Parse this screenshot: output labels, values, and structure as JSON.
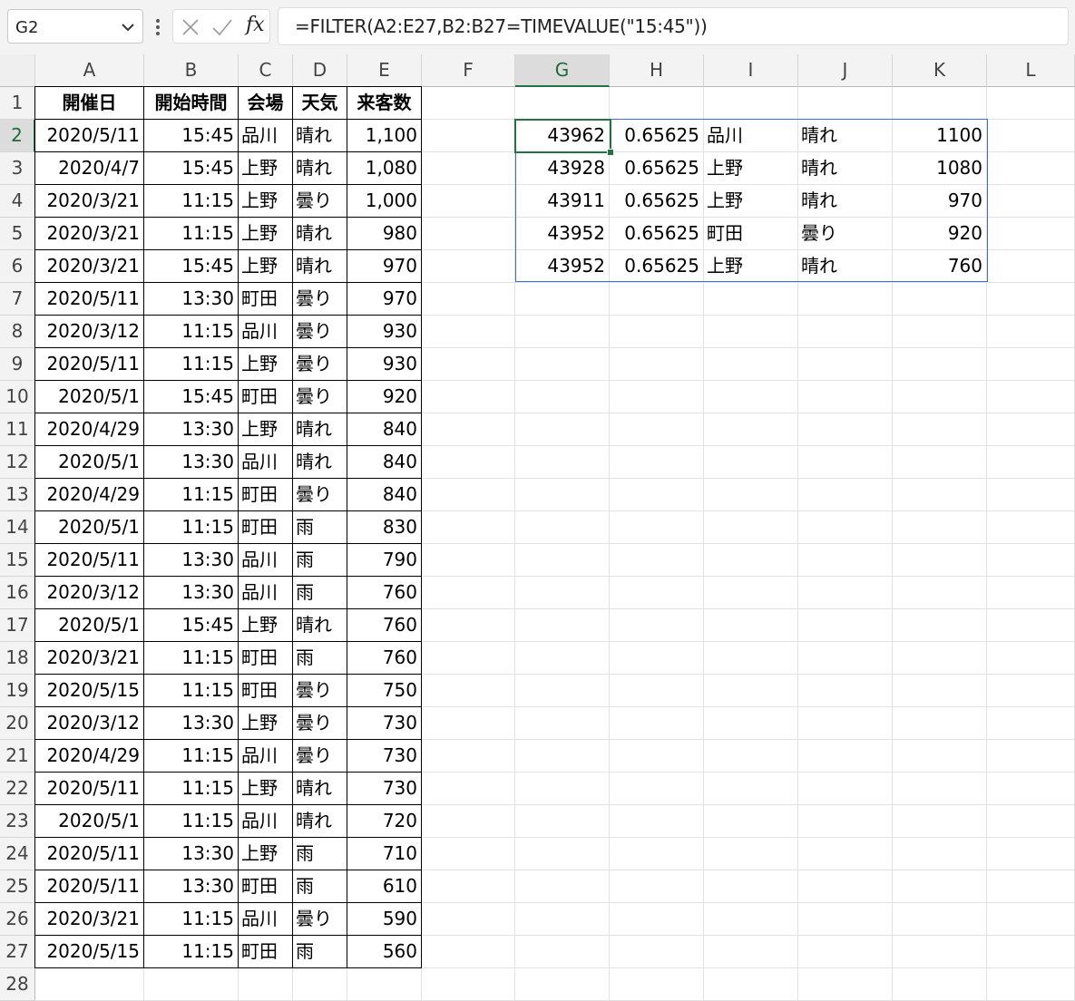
{
  "formula_bar": {
    "name_box": "G2",
    "fx_label": "fx",
    "formula": "=FILTER(A2:E27,B2:B27=TIMEVALUE(\"15:45\"))"
  },
  "selected_cell": "G2",
  "accent_color": "#217346",
  "spill_border_color": "#3b6fd0",
  "columns": [
    "A",
    "B",
    "C",
    "D",
    "E",
    "F",
    "G",
    "H",
    "I",
    "J",
    "K",
    "L"
  ],
  "rows": [
    "1",
    "2",
    "3",
    "4",
    "5",
    "6",
    "7",
    "8",
    "9",
    "10",
    "11",
    "12",
    "13",
    "14",
    "15",
    "16",
    "17",
    "18",
    "19",
    "20",
    "21",
    "22",
    "23",
    "24",
    "25",
    "26",
    "27",
    "28"
  ],
  "table": {
    "headers": [
      "開催日",
      "開始時間",
      "会場",
      "天気",
      "来客数"
    ],
    "data": [
      [
        "2020/5/11",
        "15:45",
        "品川",
        "晴れ",
        "1,100"
      ],
      [
        "2020/4/7",
        "15:45",
        "上野",
        "晴れ",
        "1,080"
      ],
      [
        "2020/3/21",
        "11:15",
        "上野",
        "曇り",
        "1,000"
      ],
      [
        "2020/3/21",
        "11:15",
        "上野",
        "晴れ",
        "980"
      ],
      [
        "2020/3/21",
        "15:45",
        "上野",
        "晴れ",
        "970"
      ],
      [
        "2020/5/11",
        "13:30",
        "町田",
        "曇り",
        "970"
      ],
      [
        "2020/3/12",
        "11:15",
        "品川",
        "曇り",
        "930"
      ],
      [
        "2020/5/11",
        "11:15",
        "上野",
        "曇り",
        "930"
      ],
      [
        "2020/5/1",
        "15:45",
        "町田",
        "曇り",
        "920"
      ],
      [
        "2020/4/29",
        "13:30",
        "上野",
        "晴れ",
        "840"
      ],
      [
        "2020/5/1",
        "13:30",
        "品川",
        "晴れ",
        "840"
      ],
      [
        "2020/4/29",
        "11:15",
        "町田",
        "曇り",
        "840"
      ],
      [
        "2020/5/1",
        "11:15",
        "町田",
        "雨",
        "830"
      ],
      [
        "2020/5/11",
        "13:30",
        "品川",
        "雨",
        "790"
      ],
      [
        "2020/3/12",
        "13:30",
        "品川",
        "雨",
        "760"
      ],
      [
        "2020/5/1",
        "15:45",
        "上野",
        "晴れ",
        "760"
      ],
      [
        "2020/3/21",
        "11:15",
        "町田",
        "雨",
        "760"
      ],
      [
        "2020/5/15",
        "11:15",
        "町田",
        "曇り",
        "750"
      ],
      [
        "2020/3/12",
        "13:30",
        "上野",
        "曇り",
        "730"
      ],
      [
        "2020/4/29",
        "11:15",
        "品川",
        "曇り",
        "730"
      ],
      [
        "2020/5/11",
        "11:15",
        "上野",
        "晴れ",
        "730"
      ],
      [
        "2020/5/1",
        "11:15",
        "品川",
        "晴れ",
        "720"
      ],
      [
        "2020/5/11",
        "13:30",
        "上野",
        "雨",
        "710"
      ],
      [
        "2020/5/11",
        "13:30",
        "町田",
        "雨",
        "610"
      ],
      [
        "2020/3/21",
        "11:15",
        "品川",
        "曇り",
        "590"
      ],
      [
        "2020/5/15",
        "11:15",
        "町田",
        "雨",
        "560"
      ]
    ]
  },
  "filter_result": [
    [
      "43962",
      "0.65625",
      "品川",
      "晴れ",
      "1100"
    ],
    [
      "43928",
      "0.65625",
      "上野",
      "晴れ",
      "1080"
    ],
    [
      "43911",
      "0.65625",
      "上野",
      "晴れ",
      "970"
    ],
    [
      "43952",
      "0.65625",
      "町田",
      "曇り",
      "920"
    ],
    [
      "43952",
      "0.65625",
      "上野",
      "晴れ",
      "760"
    ]
  ]
}
